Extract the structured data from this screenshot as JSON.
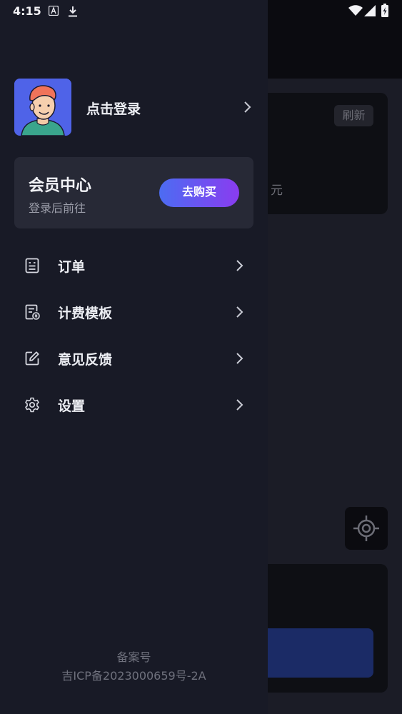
{
  "status_bar": {
    "time": "4:15"
  },
  "profile": {
    "login_label": "点击登录"
  },
  "member": {
    "title": "会员中心",
    "subtitle": "登录后前往",
    "buy_label": "去购买"
  },
  "menu": [
    {
      "label": "订单",
      "icon": "order-icon"
    },
    {
      "label": "计费模板",
      "icon": "billing-template-icon"
    },
    {
      "label": "意见反馈",
      "icon": "edit-icon"
    },
    {
      "label": "设置",
      "icon": "gear-icon"
    }
  ],
  "footer": {
    "title": "备案号",
    "icp": "吉ICP备2023000659号-2A"
  },
  "background": {
    "refresh_label": "刷新",
    "currency_label": "元"
  },
  "colors": {
    "drawer_bg": "#181a26",
    "card_bg": "#272936",
    "accent_start": "#4c6cf2",
    "accent_end": "#8a3cf0"
  }
}
